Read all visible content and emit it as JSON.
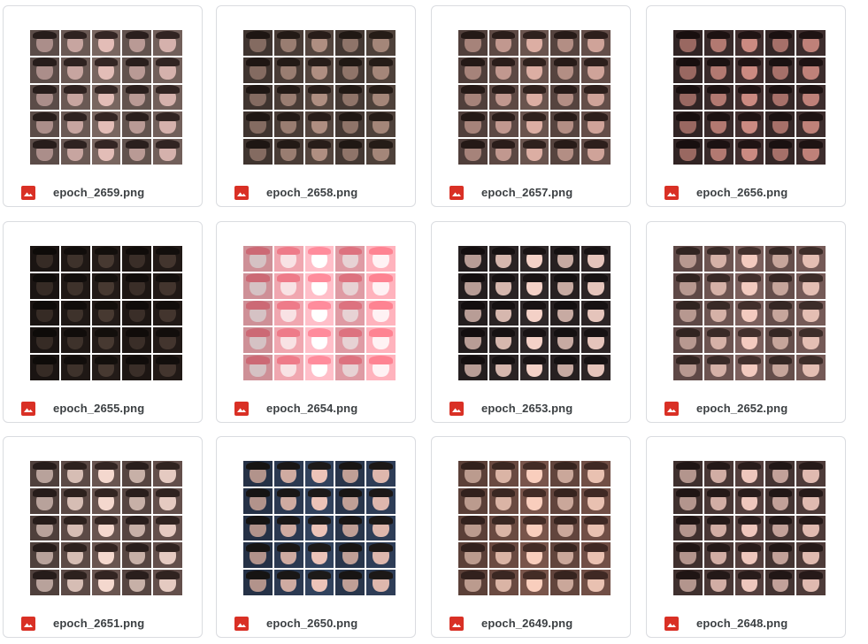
{
  "files": [
    {
      "name": "epoch_2659.png",
      "icon": "image-file-icon",
      "palette": {
        "bg": "#6b5a55",
        "face": "#c9a7a2",
        "hair": "#2e2220"
      }
    },
    {
      "name": "epoch_2658.png",
      "icon": "image-file-icon",
      "palette": {
        "bg": "#4a3d37",
        "face": "#9b7e72",
        "hair": "#231a16"
      }
    },
    {
      "name": "epoch_2657.png",
      "icon": "image-file-icon",
      "palette": {
        "bg": "#5e4a45",
        "face": "#c39a90",
        "hair": "#2a1d1a"
      }
    },
    {
      "name": "epoch_2656.png",
      "icon": "image-file-icon",
      "palette": {
        "bg": "#3a2a2a",
        "face": "#b47a72",
        "hair": "#1c1212"
      }
    },
    {
      "name": "epoch_2655.png",
      "icon": "image-file-icon",
      "palette": {
        "bg": "#1f1815",
        "face": "#3f322b",
        "hair": "#110d0b"
      }
    },
    {
      "name": "epoch_2654.png",
      "icon": "image-file-icon",
      "palette": {
        "bg": "#f2a9b2",
        "face": "#fbe4e6",
        "hair": "#f07c8a"
      }
    },
    {
      "name": "epoch_2653.png",
      "icon": "image-file-icon",
      "palette": {
        "bg": "#2a2324",
        "face": "#d8b9b0",
        "hair": "#161112"
      }
    },
    {
      "name": "epoch_2652.png",
      "icon": "image-file-icon",
      "palette": {
        "bg": "#6e5552",
        "face": "#d7b3a9",
        "hair": "#3a2a27"
      }
    },
    {
      "name": "epoch_2651.png",
      "icon": "image-file-icon",
      "palette": {
        "bg": "#5d4b47",
        "face": "#d8bfb6",
        "hair": "#2d211e"
      }
    },
    {
      "name": "epoch_2650.png",
      "icon": "image-file-icon",
      "palette": {
        "bg": "#2b3a52",
        "face": "#d1ada3",
        "hair": "#1a1716"
      }
    },
    {
      "name": "epoch_2649.png",
      "icon": "image-file-icon",
      "palette": {
        "bg": "#6b4b42",
        "face": "#dcb6a7",
        "hair": "#3b2722"
      }
    },
    {
      "name": "epoch_2648.png",
      "icon": "image-file-icon",
      "palette": {
        "bg": "#4a3836",
        "face": "#d3afa6",
        "hair": "#241918"
      }
    }
  ],
  "colors": {
    "icon_red": "#d93025",
    "border": "#dadce0",
    "text": "#3c4043"
  }
}
